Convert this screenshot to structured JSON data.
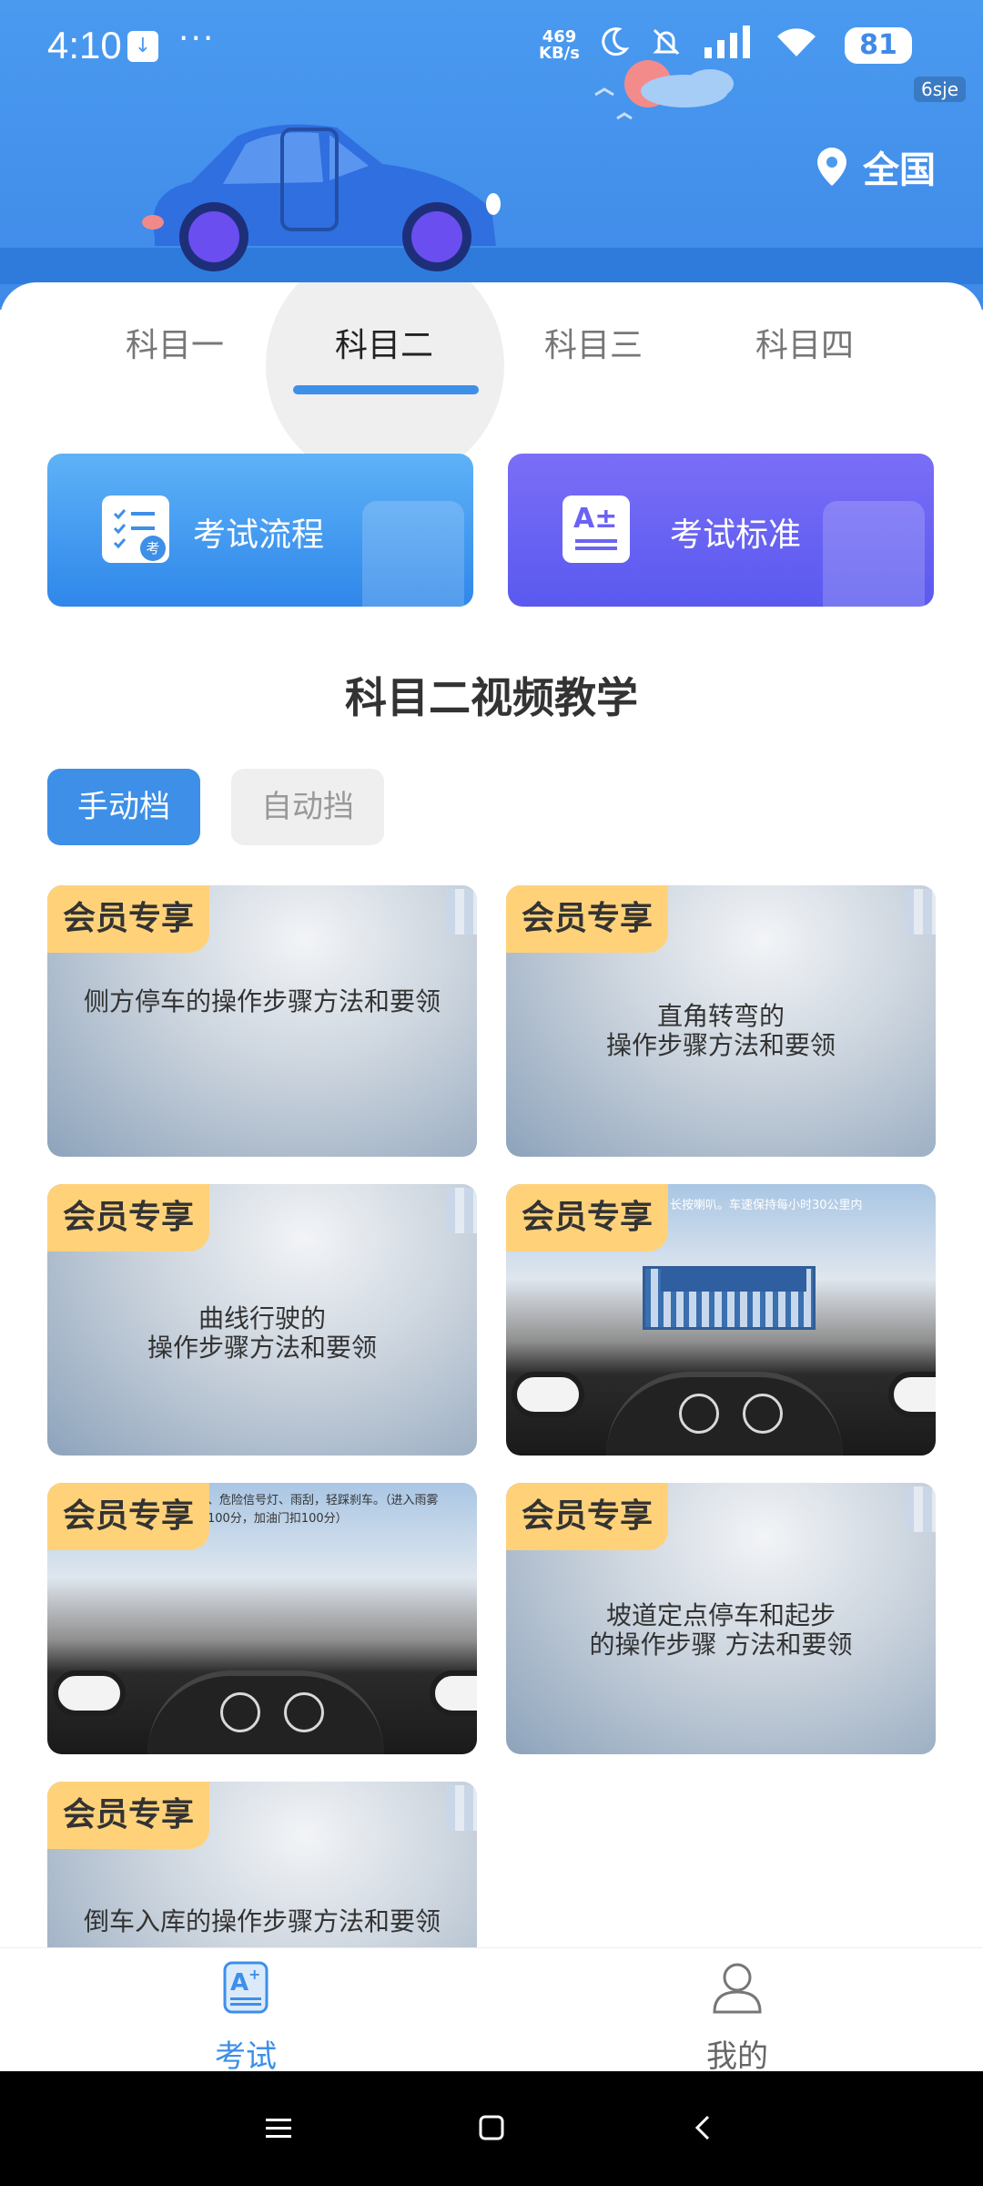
{
  "status_bar": {
    "time": "4:10",
    "download_icon": "download-arrow-icon",
    "more": "···",
    "net_speed_value": "469",
    "net_speed_unit": "KB/s",
    "battery": "81",
    "tag": "6sje"
  },
  "header": {
    "location_label": "全国",
    "location_icon": "location-pin-icon"
  },
  "subject_tabs": [
    {
      "label": "科目一",
      "active": false
    },
    {
      "label": "科目二",
      "active": true
    },
    {
      "label": "科目三",
      "active": false
    },
    {
      "label": "科目四",
      "active": false
    }
  ],
  "cards": {
    "exam_process": {
      "label": "考试流程",
      "icon": "checklist-icon",
      "icon_badge": "考"
    },
    "exam_standard": {
      "label": "考试标准",
      "icon": "grade-a-plus-icon",
      "icon_text": "A±"
    }
  },
  "section": {
    "title": "科目二视频教学"
  },
  "transmission_filters": [
    {
      "label": "手动档",
      "active": true
    },
    {
      "label": "自动挡",
      "active": false
    }
  ],
  "videos": [
    {
      "badge": "会员专享",
      "line1": "侧方停车的操作步骤方法和要领",
      "line2": ""
    },
    {
      "badge": "会员专享",
      "line1": "直角转弯的",
      "line2": "操作步骤方法和要领"
    },
    {
      "badge": "会员专享",
      "line1": "曲线行驶的",
      "line2": "操作步骤方法和要领"
    },
    {
      "badge": "会员专享",
      "overlay_text": "长按喇叭。车速保持每小时30公里内"
    },
    {
      "badge": "会员专享",
      "overlay_text": "、危险信号灯、雨刮，轻踩刹车。（进入雨雾",
      "overlay_text2": "100分，加油门扣100分）"
    },
    {
      "badge": "会员专享",
      "line1": "坡道定点停车和起步",
      "line2": "的操作步骤 方法和要领"
    },
    {
      "badge": "会员专享",
      "line1": "倒车入库的操作步骤方法和要领",
      "line2": ""
    }
  ],
  "bottom_nav": [
    {
      "label": "考试",
      "icon": "exam-a-plus-icon",
      "active": true
    },
    {
      "label": "我的",
      "icon": "person-icon",
      "active": false
    }
  ],
  "colors": {
    "primary": "#3d8fe8",
    "header": "#4a9af0",
    "badge": "#ffd27a",
    "purple_card": "#6a63f2"
  }
}
